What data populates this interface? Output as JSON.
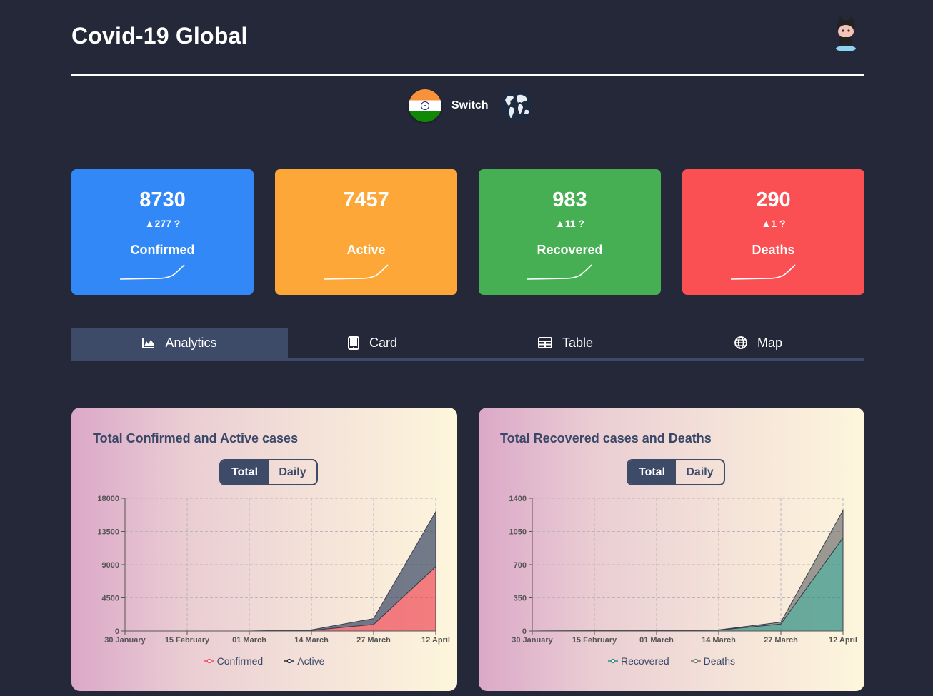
{
  "app": {
    "title": "Covid-19 Global"
  },
  "switcher": {
    "label": "Switch"
  },
  "cards": [
    {
      "id": "confirmed",
      "value": "8730",
      "delta": "▲277 ?",
      "label": "Confirmed",
      "color": "#3388f8"
    },
    {
      "id": "active",
      "value": "7457",
      "delta": "",
      "label": "Active",
      "color": "#fca738"
    },
    {
      "id": "recovered",
      "value": "983",
      "delta": "▲11 ?",
      "label": "Recovered",
      "color": "#46af53"
    },
    {
      "id": "deaths",
      "value": "290",
      "delta": "▲1 ?",
      "label": "Deaths",
      "color": "#fa4f53"
    }
  ],
  "tabs": [
    {
      "label": "Analytics",
      "icon": "area-chart-icon",
      "active": true
    },
    {
      "label": "Card",
      "icon": "tablet-icon",
      "active": false
    },
    {
      "label": "Table",
      "icon": "table-icon",
      "active": false
    },
    {
      "label": "Map",
      "icon": "globe-icon",
      "active": false
    }
  ],
  "panels": [
    {
      "title": "Total Confirmed and Active cases",
      "toggle": [
        "Total",
        "Daily"
      ],
      "legend": [
        "Confirmed",
        "Active"
      ]
    },
    {
      "title": "Total Recovered cases and Deaths",
      "toggle": [
        "Total",
        "Daily"
      ],
      "legend": [
        "Recovered",
        "Deaths"
      ]
    }
  ],
  "chart_data": [
    {
      "type": "area",
      "title": "Total Confirmed and Active cases",
      "x": [
        "30 January",
        "15 February",
        "01 March",
        "14 March",
        "27 March",
        "12 April"
      ],
      "x_ticks": [
        "30 January",
        "15 February",
        "01 March",
        "14 March",
        "27 March",
        "12 April"
      ],
      "y_ticks": [
        "0",
        "4500",
        "9000",
        "13500",
        "18000"
      ],
      "ylim": [
        0,
        18000
      ],
      "stacked": true,
      "series": [
        {
          "name": "Confirmed",
          "color": "#ee4d5a",
          "values": [
            1,
            3,
            3,
            84,
            887,
            8730
          ]
        },
        {
          "name": "Active",
          "color": "#3d4b68",
          "values": [
            1,
            1,
            1,
            72,
            797,
            7457
          ]
        }
      ]
    },
    {
      "type": "area",
      "title": "Total Recovered cases and Deaths",
      "x": [
        "30 January",
        "15 February",
        "01 March",
        "14 March",
        "27 March",
        "12 April"
      ],
      "x_ticks": [
        "30 January",
        "15 February",
        "01 March",
        "14 March",
        "27 March",
        "12 April"
      ],
      "y_ticks": [
        "0",
        "350",
        "700",
        "1050",
        "1400"
      ],
      "ylim": [
        0,
        1400
      ],
      "stacked": true,
      "series": [
        {
          "name": "Recovered",
          "color": "#2f8f83",
          "values": [
            0,
            3,
            3,
            10,
            73,
            983
          ]
        },
        {
          "name": "Deaths",
          "color": "#767676",
          "values": [
            0,
            0,
            0,
            2,
            20,
            290
          ]
        }
      ]
    }
  ]
}
